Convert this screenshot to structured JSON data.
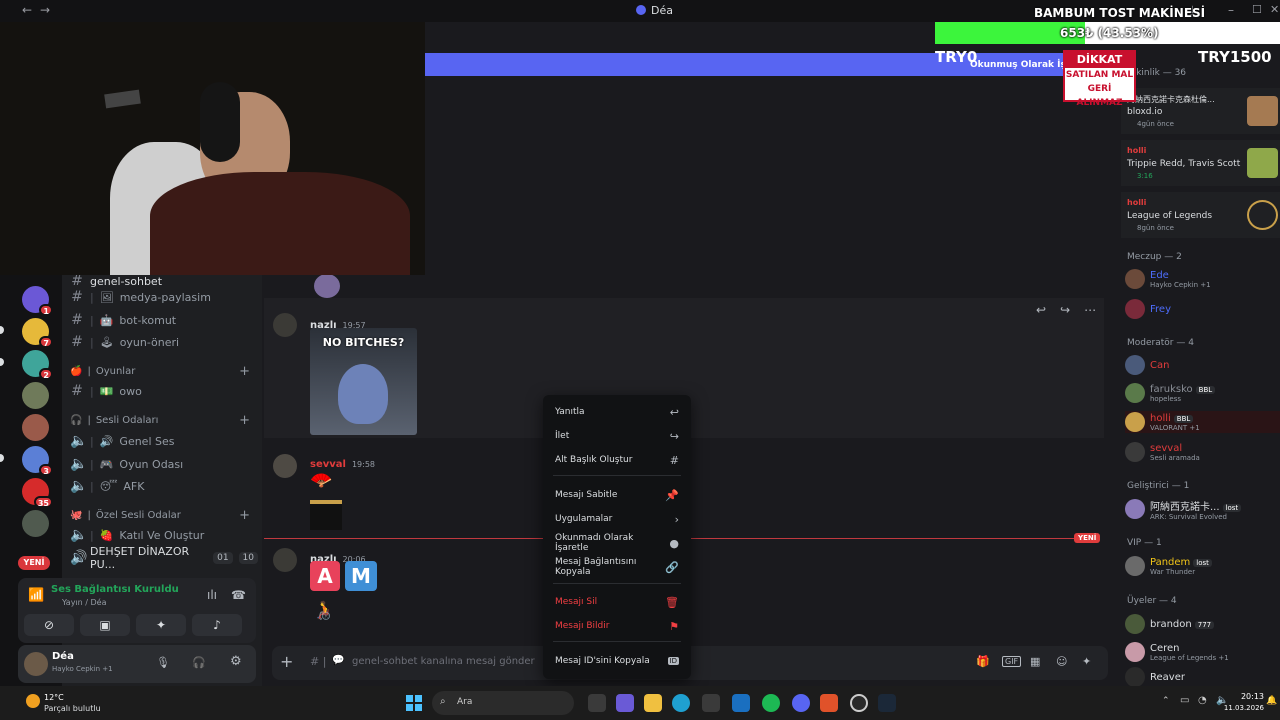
{
  "titlebar": {
    "title": "Déa",
    "back": "←",
    "forward": "→"
  },
  "overlay": {
    "goal_title": "BAMBUM TOST MAKİNESİ",
    "progress_text": "653₺ (43.53%)",
    "progress_fraction": 0.4353,
    "goal_min": "TRY0",
    "goal_max": "TRY1500",
    "warning_title": "DİKKAT",
    "warning_line1": "SATILAN MAL",
    "warning_line2": "GERİ ALINMAZ",
    "banner_text": "Okunmuş Olarak İşaretle"
  },
  "rail_badges": [
    "1",
    "7",
    "2",
    "3",
    "35"
  ],
  "rail_new_label": "YENİ",
  "channels": {
    "top_channel": "genel-sohbet",
    "items": [
      {
        "name": "medya-paylasim",
        "emoji": "🖼"
      },
      {
        "name": "bot-komut",
        "emoji": "🤖"
      },
      {
        "name": "oyun-öneri",
        "emoji": "🕹"
      }
    ],
    "cat_games": "Oyunlar",
    "games_channel": "owo",
    "cat_voice": "Sesli Odaları",
    "voice_channels": [
      {
        "name": "Genel Ses",
        "emoji": "🔊"
      },
      {
        "name": "Oyun Odası",
        "emoji": "🎮"
      },
      {
        "name": "AFK",
        "emoji": "😴"
      }
    ],
    "cat_private": "Özel Sesli Odalar",
    "private_channels": [
      {
        "name": "Katıl Ve Oluştur",
        "emoji": "🍓"
      },
      {
        "name": "DEHŞET DİNAZOR PU...",
        "pill1": "01",
        "pill2": "10"
      }
    ]
  },
  "voice_panel": {
    "status": "Ses Bağlantısı Kuruldu",
    "sub": "Yayın / Déa"
  },
  "user_panel": {
    "name": "Déa",
    "status": "Hayko Cepkin +1"
  },
  "messages": [
    {
      "user": "nazlı",
      "time": "19:57",
      "image_caption": "NO BITCHES?",
      "color": "#dbdee1"
    },
    {
      "user": "sevval",
      "time": "19:58",
      "color": "#e03c3c"
    },
    {
      "user": "nazlı",
      "time": "20:06",
      "tiles": [
        "A",
        "M"
      ],
      "color": "#dbdee1"
    }
  ],
  "new_marker": "YENİ",
  "composer": {
    "placeholder": "genel-sohbet kanalına mesaj gönder"
  },
  "context_menu": {
    "items": [
      {
        "label": "Yanıtla",
        "icon": "↩",
        "danger": false
      },
      {
        "label": "İlet",
        "icon": "↪",
        "danger": false
      },
      {
        "label": "Alt Başlık Oluştur",
        "icon": "#",
        "danger": false
      },
      {
        "label": "Mesajı Sabitle",
        "icon": "📌",
        "danger": false
      },
      {
        "label": "Uygulamalar",
        "icon": "›",
        "danger": false
      },
      {
        "label": "Okunmadı Olarak İşaretle",
        "icon": "●",
        "danger": false
      },
      {
        "label": "Mesaj Bağlantısını Kopyala",
        "icon": "🔗",
        "danger": false
      },
      {
        "label": "Mesajı Sil",
        "icon": "🗑",
        "danger": true
      },
      {
        "label": "Mesajı Bildir",
        "icon": "⚑",
        "danger": true
      },
      {
        "label": "Mesaj ID'sini Kopyala",
        "icon": "ID",
        "danger": false
      }
    ]
  },
  "members": {
    "group_activity": "Etkinlik — 36",
    "activities": [
      {
        "name": "阿納西克諾卡克森杜倫...",
        "game": "bloxd.io",
        "time": "4gün önce",
        "color": "#dbdee1"
      },
      {
        "name": "holli",
        "game": "Trippie Redd, Travis Scott",
        "time": "3:16",
        "color": "#e03c3c"
      },
      {
        "name": "holli",
        "game": "League of Legends",
        "time": "8gün önce",
        "color": "#e03c3c"
      }
    ],
    "group_meczup": "Meczup — 2",
    "meczup": [
      {
        "name": "Ede",
        "status": "Hayko Cepkin +1",
        "color": "#4d6cfa"
      },
      {
        "name": "Frey",
        "status": "",
        "color": "#4d6cfa"
      }
    ],
    "group_mod": "Moderatör — 4",
    "mods": [
      {
        "name": "Can",
        "status": "",
        "color": "#e03c3c",
        "tag": ""
      },
      {
        "name": "faruksko",
        "status": "hopeless",
        "color": "#8b8f97",
        "tag": "BBL"
      },
      {
        "name": "holli",
        "status": "VALORANT +1",
        "color": "#e03c3c",
        "tag": "BBL"
      },
      {
        "name": "sevval",
        "status": "Sesli aramada",
        "color": "#e03c3c",
        "tag": ""
      }
    ],
    "group_dev": "Geliştirici — 1",
    "devs": [
      {
        "name": "阿納西克諾卡...",
        "status": "ARK: Survival Evolved",
        "tag": "lost"
      }
    ],
    "group_vip": "VIP — 1",
    "vips": [
      {
        "name": "Pandem",
        "status": "War Thunder",
        "tag": "lost",
        "color": "#f0c419"
      }
    ],
    "group_members": "Üyeler — 4",
    "users": [
      {
        "name": "brandon",
        "status": "",
        "tag": "777"
      },
      {
        "name": "Ceren",
        "status": "League of Legends +1",
        "tag": ""
      },
      {
        "name": "Reaver",
        "status": "",
        "tag": ""
      }
    ]
  },
  "taskbar": {
    "weather_temp": "12°C",
    "weather_desc": "Parçalı bulutlu",
    "search": "Ara",
    "time": "20:13",
    "date": "11.03.2026"
  }
}
